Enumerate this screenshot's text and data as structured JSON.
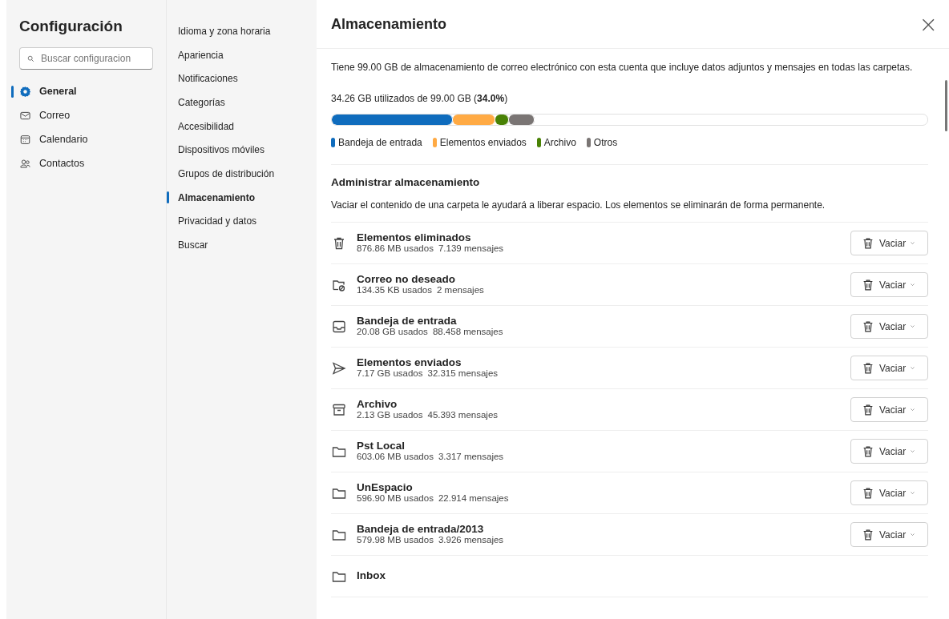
{
  "sidebar": {
    "title": "Configuración",
    "search": {
      "placeholder": "Buscar configuracion"
    },
    "items": [
      {
        "label": "General",
        "selected": true
      },
      {
        "label": "Correo",
        "selected": false
      },
      {
        "label": "Calendario",
        "selected": false
      },
      {
        "label": "Contactos",
        "selected": false
      }
    ]
  },
  "subnav": {
    "items": [
      {
        "label": "Idioma y zona horaria",
        "selected": false
      },
      {
        "label": "Apariencia",
        "selected": false
      },
      {
        "label": "Notificaciones",
        "selected": false
      },
      {
        "label": "Categorías",
        "selected": false
      },
      {
        "label": "Accesibilidad",
        "selected": false
      },
      {
        "label": "Dispositivos móviles",
        "selected": false
      },
      {
        "label": "Grupos de distribución",
        "selected": false
      },
      {
        "label": "Almacenamiento",
        "selected": true
      },
      {
        "label": "Privacidad y datos",
        "selected": false
      },
      {
        "label": "Buscar",
        "selected": false
      }
    ]
  },
  "panel": {
    "title": "Almacenamiento",
    "close": "×",
    "intro": "Tiene 99.00 GB de almacenamiento de correo electrónico con esta cuenta que incluye datos adjuntos y mensajes en todas las carpetas.",
    "usage": "34.26 GB utilizados de 99.00 GB (**34.0%**)",
    "segments": [
      {
        "label": "Bandeja de entrada",
        "color": "#0f6cbd"
      },
      {
        "label": "Elementos enviados",
        "color": "#ffaa44"
      },
      {
        "label": "Archivo",
        "color": "#498205"
      },
      {
        "label": "Otros",
        "color": "#7a7574"
      }
    ],
    "manage_title": "Administrar almacenamiento",
    "manage_text": "Vaciar el contenido de una carpeta le ayudará a liberar espacio. Los elementos se eliminarán de forma permanente.",
    "folders": [
      {
        "kind": "trash",
        "name": "Elementos eliminados",
        "size": "876.86 MB usados",
        "count": "7.139 mensajes",
        "button": "Vaciar"
      },
      {
        "kind": "junk",
        "name": "Correo no deseado",
        "size": "134.35 KB usados",
        "count": "2 mensajes",
        "button": "Vaciar"
      },
      {
        "kind": "inbox",
        "name": "Bandeja de entrada",
        "size": "20.08 GB usados",
        "count": "88.458 mensajes",
        "button": "Vaciar"
      },
      {
        "kind": "sent",
        "name": "Elementos enviados",
        "size": "7.17 GB usados",
        "count": "32.315 mensajes",
        "button": "Vaciar"
      },
      {
        "kind": "archive",
        "name": "Archivo",
        "size": "2.13 GB usados",
        "count": "45.393 mensajes",
        "button": "Vaciar"
      },
      {
        "kind": "folder",
        "name": "Pst Local",
        "size": "603.06 MB usados",
        "count": "3.317 mensajes",
        "button": "Vaciar"
      },
      {
        "kind": "folder",
        "name": "UnEspacio",
        "size": "596.90 MB usados",
        "count": "22.914 mensajes",
        "button": "Vaciar"
      },
      {
        "kind": "folder",
        "name": "Bandeja de entrada/2013",
        "size": "579.98 MB usados",
        "count": "3.926 mensajes",
        "button": "Vaciar"
      },
      {
        "kind": "folder",
        "name": "Inbox"
      }
    ]
  }
}
